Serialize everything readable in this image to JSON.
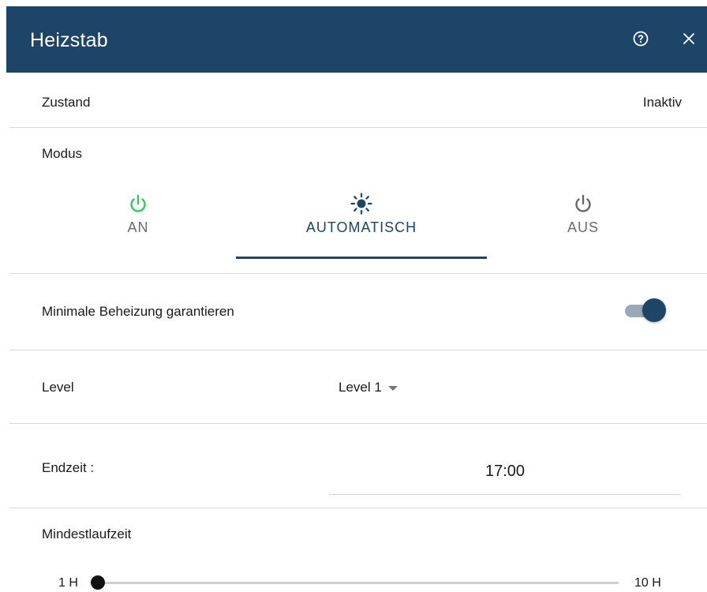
{
  "dialog": {
    "title": "Heizstab",
    "help_icon": "help-circle-icon",
    "close_icon": "close-icon",
    "header_color": "#1d4568"
  },
  "state": {
    "label": "Zustand",
    "value": "Inaktiv"
  },
  "mode": {
    "label": "Modus",
    "tabs": [
      {
        "label": "AN",
        "icon": "power-icon",
        "icon_color": "#2ecc55",
        "active": false
      },
      {
        "label": "AUTOMATISCH",
        "icon": "sun-icon",
        "icon_color": "#1d4568",
        "active": true
      },
      {
        "label": "AUS",
        "icon": "power-icon",
        "icon_color": "#666666",
        "active": false
      }
    ]
  },
  "min_heating": {
    "label": "Minimale Beheizung garantieren",
    "enabled": true
  },
  "level": {
    "label": "Level",
    "selected": "Level 1"
  },
  "end_time": {
    "label": "Endzeit :",
    "value": "17:00"
  },
  "min_runtime": {
    "label": "Mindestlaufzeit",
    "min_label": "1 H",
    "max_label": "10 H",
    "value_fraction": 0
  }
}
